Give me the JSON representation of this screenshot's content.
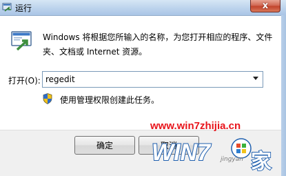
{
  "window": {
    "title": "运行",
    "close_glyph": "x"
  },
  "dialog": {
    "description": "Windows 将根据您所输入的名称，为您打开相应的程序、文件夹、文档或 Internet 资源。",
    "open_label": "打开(O):",
    "command_value": "regedit",
    "admin_note": "使用管理权限创建此任务。"
  },
  "buttons": {
    "ok": "确定",
    "cancel": "取消"
  },
  "watermark": {
    "url": "www.win7zhijia.cn",
    "logo_text": "WIN7之家",
    "sub_text": "jingyan"
  },
  "icons": {
    "title": "run-icon",
    "main": "run-dialog-icon",
    "shield": "uac-shield-icon",
    "dropdown": "dropdown-arrow-icon",
    "close": "close-icon"
  },
  "colors": {
    "watermark_red": "#e8141b",
    "footer_bg": "#f0f0f0",
    "input_border": "#7a9ab8",
    "close_red": "#c2442c"
  }
}
